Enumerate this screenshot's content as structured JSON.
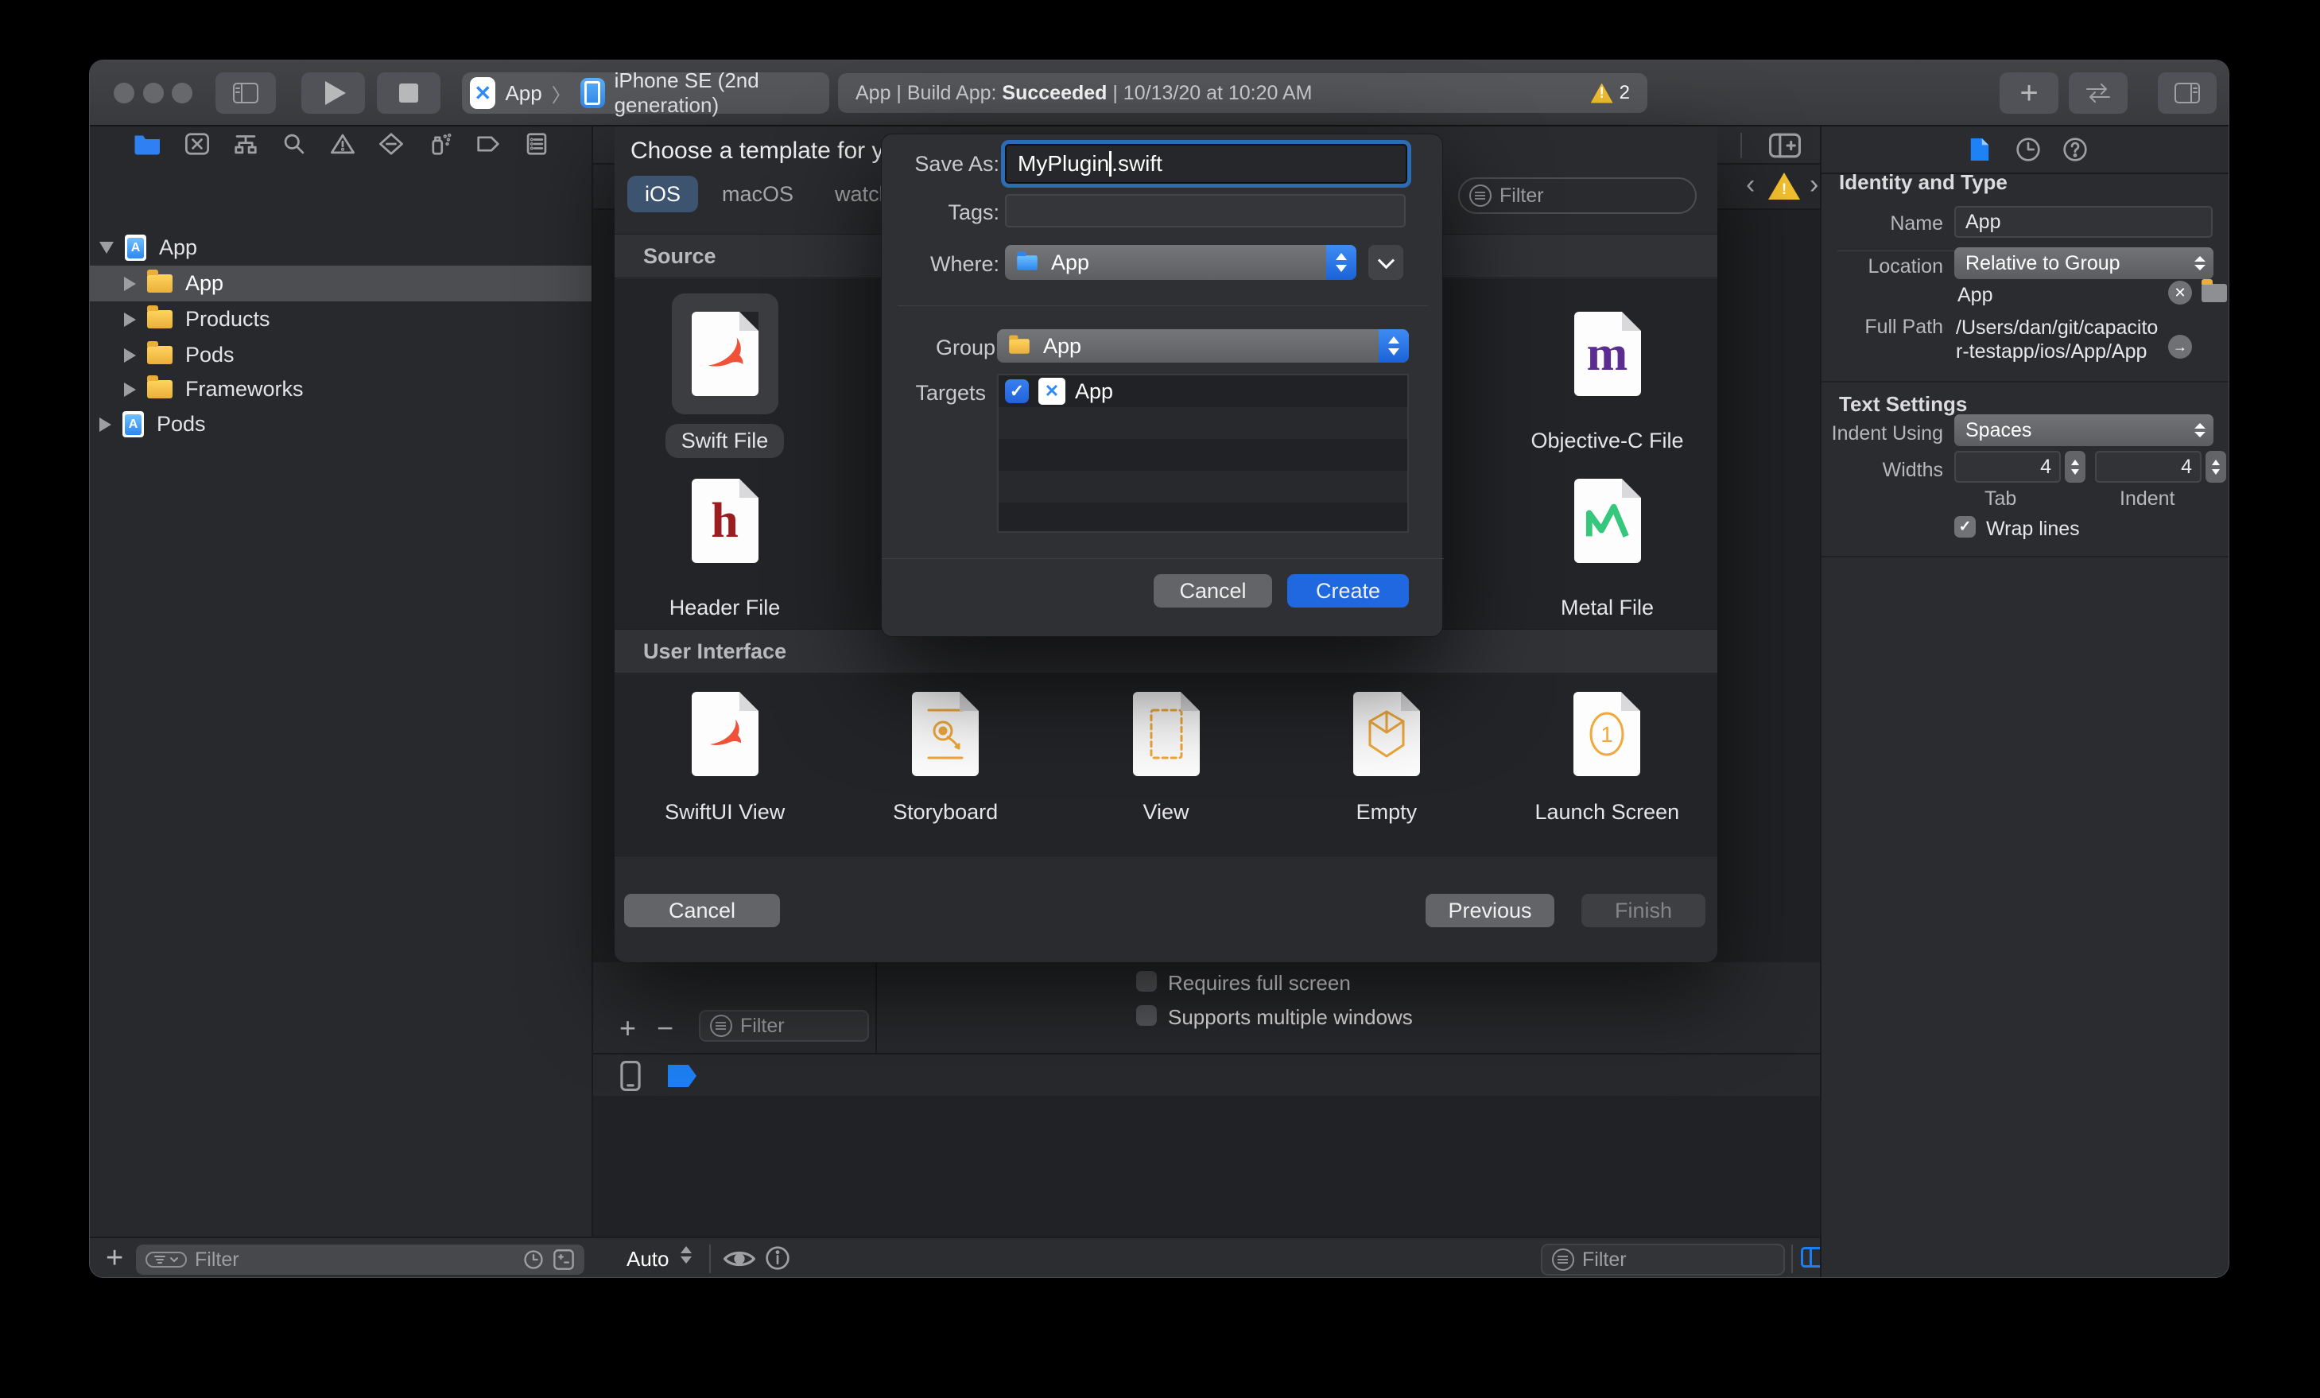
{
  "toolbar": {
    "scheme_project": "App",
    "scheme_separator": "〉",
    "scheme_destination": "iPhone SE (2nd generation)",
    "status_part1": "App | Build App: ",
    "status_bold": "Succeeded",
    "status_part2": " | 10/13/20 at 10:20 AM",
    "warning_count": "2"
  },
  "navigator": {
    "rows": [
      {
        "label": "App"
      },
      {
        "label": "App"
      },
      {
        "label": "Products"
      },
      {
        "label": "Pods"
      },
      {
        "label": "Frameworks"
      },
      {
        "label": "Pods"
      }
    ],
    "add_label": "+",
    "filter_placeholder": "Filter"
  },
  "sheet": {
    "title": "Choose a template for your",
    "tabs": [
      {
        "label": "iOS"
      },
      {
        "label": "macOS"
      },
      {
        "label": "watchOS"
      }
    ],
    "filter_placeholder": "Filter",
    "sections": [
      {
        "title": "Source",
        "items": [
          {
            "label": "Swift File"
          },
          {
            "label": "Objective-C File"
          },
          {
            "label": "Header File"
          },
          {
            "label": "Metal File"
          }
        ]
      },
      {
        "title": "User Interface",
        "items": [
          {
            "label": "SwiftUI View"
          },
          {
            "label": "Storyboard"
          },
          {
            "label": "View"
          },
          {
            "label": "Empty"
          },
          {
            "label": "Launch Screen"
          }
        ]
      }
    ],
    "cancel_label": "Cancel",
    "previous_label": "Previous",
    "finish_label": "Finish"
  },
  "save_dialog": {
    "save_as_label": "Save As:",
    "filename_before_caret": "MyPlugin",
    "filename_after_caret": ".swift",
    "tags_label": "Tags:",
    "where_label": "Where:",
    "where_value": "App",
    "group_label": "Group",
    "group_value": "App",
    "targets_label": "Targets",
    "target_name": "App",
    "cancel_label": "Cancel",
    "create_label": "Create"
  },
  "editor": {
    "add_label": "+",
    "remove_label": "−",
    "deploy_filter_placeholder": "Filter",
    "checkbox1": "Requires full screen",
    "checkbox2": "Supports multiple windows",
    "auto_label": "Auto",
    "bottom_filter_placeholder": "Filter"
  },
  "inspector": {
    "identity_title": "Identity and Type",
    "name_label": "Name",
    "name_value": "App",
    "location_label": "Location",
    "location_value": "Relative to Group",
    "location_item": "App",
    "fullpath_label": "Full Path",
    "fullpath_value": "/Users/dan/git/capacitor-testapp/ios/App/App",
    "text_title": "Text Settings",
    "indent_label": "Indent Using",
    "indent_value": "Spaces",
    "widths_label": "Widths",
    "tab_value": "4",
    "tab_label": "Tab",
    "indent_width_value": "4",
    "indent_sub_label": "Indent",
    "wrap_label": "Wrap lines"
  }
}
